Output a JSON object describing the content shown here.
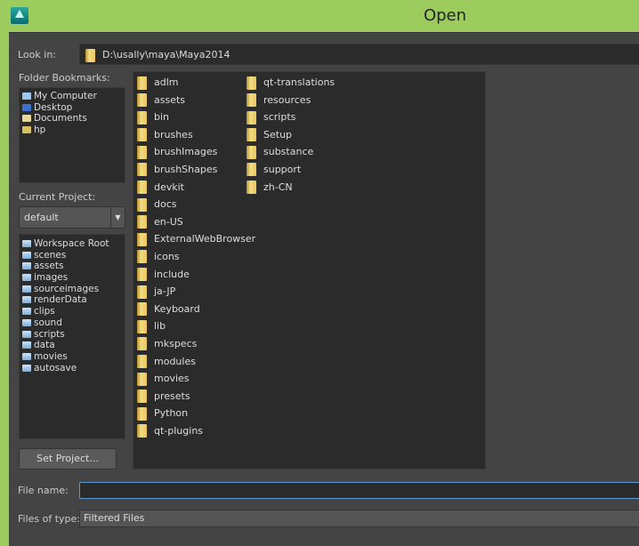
{
  "window": {
    "title": "Open"
  },
  "look_in": {
    "label": "Look in:",
    "path": "D:\\usally\\maya\\Maya2014"
  },
  "bookmarks": {
    "label": "Folder Bookmarks:",
    "items": [
      {
        "label": "My Computer",
        "icon": "computer-icon"
      },
      {
        "label": "Desktop",
        "icon": "desktop-icon"
      },
      {
        "label": "Documents",
        "icon": "documents-icon"
      },
      {
        "label": "hp",
        "icon": "user-folder-icon"
      }
    ]
  },
  "project": {
    "label": "Current Project:",
    "selected": "default",
    "items": [
      "Workspace Root",
      "scenes",
      "assets",
      "images",
      "sourceimages",
      "renderData",
      "clips",
      "sound",
      "scripts",
      "data",
      "movies",
      "autosave"
    ],
    "set_button": "Set Project..."
  },
  "files": {
    "col1": [
      "adlm",
      "assets",
      "bin",
      "brushes",
      "brushImages",
      "brushShapes",
      "devkit",
      "docs",
      "en-US",
      "ExternalWebBrowser",
      "icons",
      "include",
      "ja-JP",
      "Keyboard",
      "lib",
      "mkspecs",
      "modules",
      "movies",
      "presets",
      "Python",
      "qt-plugins"
    ],
    "col2": [
      "qt-translations",
      "resources",
      "scripts",
      "Setup",
      "substance",
      "support",
      "zh-CN"
    ]
  },
  "file_name": {
    "label": "File name:",
    "value": ""
  },
  "file_type": {
    "label": "Files of type:",
    "value": "Filtered Files"
  },
  "colors": {
    "titlebar": "#9ccc5e",
    "dialog": "#444444",
    "focus": "#5a9ad6"
  }
}
